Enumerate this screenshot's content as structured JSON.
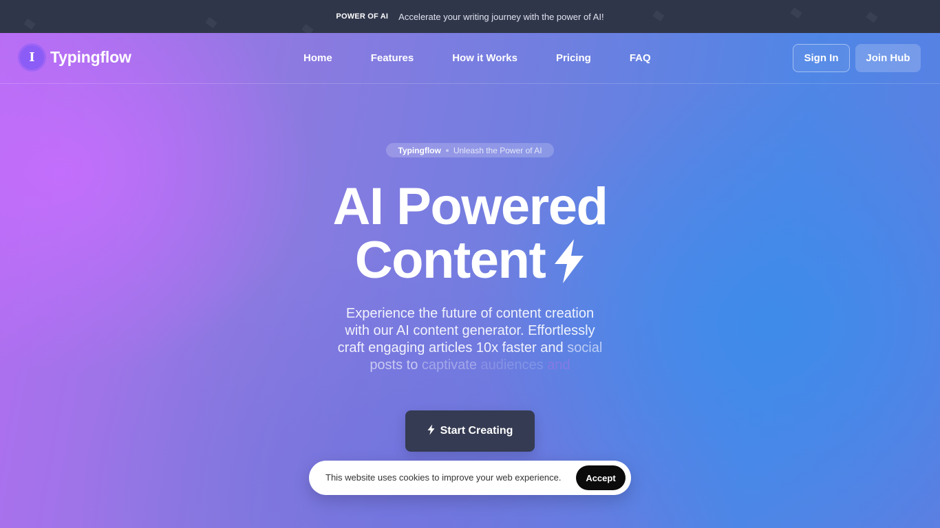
{
  "announcement": {
    "badge": "POWER OF AI",
    "text": "Accelerate your writing journey with the power of AI!"
  },
  "brand": {
    "name": "Typingflow",
    "logo_glyph": "I",
    "logo_color": "#8b5cf6"
  },
  "nav": {
    "links": [
      "Home",
      "Features",
      "How it Works",
      "Pricing",
      "FAQ"
    ],
    "sign_in": "Sign In",
    "join": "Join Hub"
  },
  "hero": {
    "pill_brand": "Typingflow",
    "pill_tagline": "Unleash the Power of AI",
    "headline_line1": "AI Powered",
    "headline_line2": "Content",
    "headline_icon": "lightning-bolt-icon",
    "subtext_lines": [
      "Experience the future of content creation",
      "with our AI content generator. Effortlessly",
      "craft engaging articles 10x faster and"
    ],
    "subtext_tail": {
      "w1": "social",
      "w2": "posts to",
      "w3": "captivate",
      "w4": "audiences",
      "w5": "and"
    },
    "cta_label": "Start Creating",
    "cta_icon": "lightning-bolt-icon"
  },
  "cookie": {
    "text": "This website uses cookies to improve your web experience.",
    "accept": "Accept"
  },
  "colors": {
    "topbar_bg": "#30364a",
    "cta_bg": "#353b52",
    "gradient_left": "#b46df2",
    "gradient_right": "#4f86e6"
  }
}
